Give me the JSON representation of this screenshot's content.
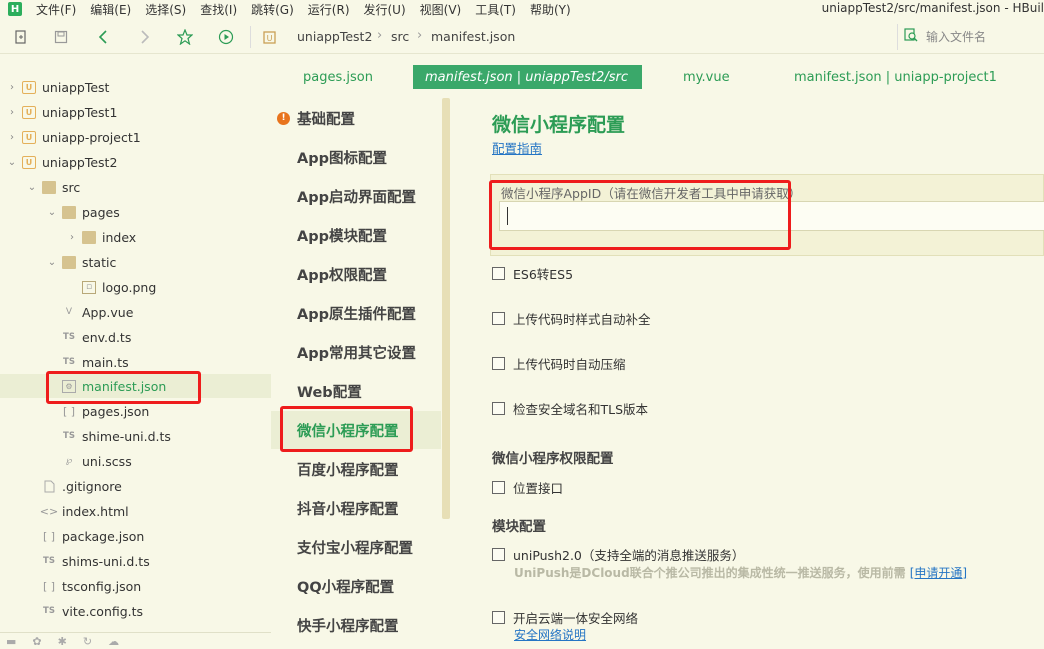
{
  "menubar": {
    "logo": "H",
    "items": [
      "文件(F)",
      "编辑(E)",
      "选择(S)",
      "查找(I)",
      "跳转(G)",
      "运行(R)",
      "发行(U)",
      "视图(V)",
      "工具(T)",
      "帮助(Y)"
    ],
    "window_title": "uniappTest2/src/manifest.json - HBuil"
  },
  "toolbar": {
    "icons": [
      "new-file-icon",
      "save-icon",
      "back-icon",
      "forward-icon",
      "star-icon",
      "run-icon"
    ],
    "breadcrumb": [
      "uniappTest2",
      "src",
      "manifest.json"
    ],
    "search_placeholder": "输入文件名"
  },
  "tree": {
    "items": [
      {
        "label": "uniappTest",
        "icon": "project-icon",
        "chevron": "right"
      },
      {
        "label": "uniappTest1",
        "icon": "project-icon",
        "chevron": "right"
      },
      {
        "label": "uniapp-project1",
        "icon": "project-icon",
        "chevron": "right"
      },
      {
        "label": "uniappTest2",
        "icon": "project-icon",
        "chevron": "down"
      },
      {
        "label": "src",
        "icon": "folder-icon",
        "chevron": "down"
      },
      {
        "label": "pages",
        "icon": "folder-icon",
        "chevron": "down"
      },
      {
        "label": "index",
        "icon": "folder-icon",
        "chevron": "right"
      },
      {
        "label": "static",
        "icon": "folder-icon",
        "chevron": "down"
      },
      {
        "label": "logo.png",
        "icon": "image-file-icon"
      },
      {
        "label": "App.vue",
        "icon": "vue-file-icon"
      },
      {
        "label": "env.d.ts",
        "icon": "ts-file-icon"
      },
      {
        "label": "main.ts",
        "icon": "ts-file-icon"
      },
      {
        "label": "manifest.json",
        "icon": "manifest-file-icon"
      },
      {
        "label": "pages.json",
        "icon": "json-file-icon"
      },
      {
        "label": "shime-uni.d.ts",
        "icon": "ts-file-icon"
      },
      {
        "label": "uni.scss",
        "icon": "scss-file-icon"
      },
      {
        "label": ".gitignore",
        "icon": "file-icon"
      },
      {
        "label": "index.html",
        "icon": "html-file-icon"
      },
      {
        "label": "package.json",
        "icon": "json-file-icon"
      },
      {
        "label": "shims-uni.d.ts",
        "icon": "ts-file-icon"
      },
      {
        "label": "tsconfig.json",
        "icon": "json-file-icon"
      },
      {
        "label": "vite.config.ts",
        "icon": "ts-file-icon"
      }
    ]
  },
  "tabs": [
    {
      "label": "pages.json",
      "active": false
    },
    {
      "label": "manifest.json | uniappTest2/src",
      "active": true
    },
    {
      "label": "my.vue",
      "active": false
    },
    {
      "label": "manifest.json | uniapp-project1",
      "active": false
    }
  ],
  "settings_nav": {
    "items": [
      {
        "label": "基础配置",
        "warning": "!"
      },
      {
        "label": "App图标配置"
      },
      {
        "label": "App启动界面配置"
      },
      {
        "label": "App模块配置"
      },
      {
        "label": "App权限配置"
      },
      {
        "label": "App原生插件配置"
      },
      {
        "label": "App常用其它设置"
      },
      {
        "label": "Web配置"
      },
      {
        "label": "微信小程序配置",
        "active": true
      },
      {
        "label": "百度小程序配置"
      },
      {
        "label": "抖音小程序配置"
      },
      {
        "label": "支付宝小程序配置"
      },
      {
        "label": "QQ小程序配置"
      },
      {
        "label": "快手小程序配置"
      }
    ]
  },
  "content": {
    "title": "微信小程序配置",
    "guide_link": "配置指南",
    "appid_label": "微信小程序AppID（请在微信开发者工具中申请获取）",
    "appid_value": "",
    "checks": [
      {
        "label": "ES6转ES5",
        "checked": false
      },
      {
        "label": "上传代码时样式自动补全",
        "checked": false
      },
      {
        "label": "上传代码时自动压缩",
        "checked": false
      },
      {
        "label": "检查安全域名和TLS版本",
        "checked": false
      }
    ],
    "permission_section": "微信小程序权限配置",
    "location_label": "位置接口",
    "module_section": "模块配置",
    "unipush_label": "uniPush2.0（支持全端的消息推送服务）",
    "unipush_note": "UniPush是DCloud联合个推公司推出的集成性统一推送服务，使用前需",
    "unipush_apply": "[申请开通]",
    "cloud_label": "开启云端一体安全网络",
    "cloud_link": "安全网络说明"
  },
  "colors": {
    "accent": "#2c9c55",
    "active_tab": "#3aa86a",
    "background": "#f8f8e7",
    "link": "#2575c4",
    "highlight": "#ee1c1c"
  }
}
